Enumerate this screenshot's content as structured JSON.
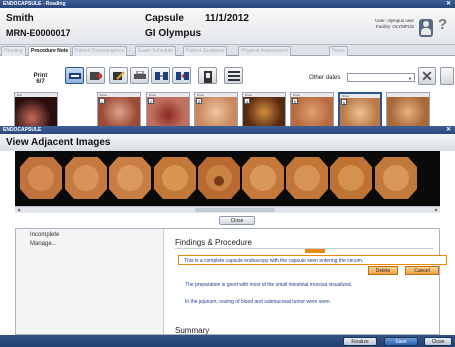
{
  "app": {
    "title": "ENDOCAPSULE - Reading"
  },
  "patient": {
    "name": "Smith",
    "mrn": "MRN-E0000017",
    "capsule_label": "Capsule",
    "date": "11/1/2012",
    "type": "GI Olympus"
  },
  "user": {
    "line1": "User: olympus user",
    "line2": "Facility: OLYMPUS"
  },
  "tabs": [
    "Reading",
    "Procedure Note",
    "Patient Demographics",
    "Exam Schedule",
    "Patient Guidance",
    "Physical Assessment",
    "Notes"
  ],
  "toolbar": {
    "print_label": "Print",
    "print_count": "6/7",
    "other_dates_label": "Other dates",
    "other_dates_value": ""
  },
  "thumbnails": [
    {
      "header": "Exit",
      "number": ""
    },
    {
      "header": "Draw",
      "number": "1"
    },
    {
      "header": "Draw",
      "number": "2"
    },
    {
      "header": "Draw",
      "number": "3"
    },
    {
      "header": "Draw",
      "number": "4"
    },
    {
      "header": "Draw",
      "number": "5"
    },
    {
      "header": "Draw",
      "number": "6"
    }
  ],
  "overlay": {
    "title": "ENDOCAPSULE",
    "heading": "View Adjacent Images",
    "close_label": "Close"
  },
  "left_list": [
    "Incomplete",
    "Manage..."
  ],
  "findings": {
    "heading": "Findings & Procedure",
    "selected_sentence": "This is a complete capsule endoscopy with the capsule seen entering the cecum.",
    "delete_label": "Delete",
    "cancel_label": "Cancel",
    "para1": "The preparation is good with most of the small intestinal mucosa visualized.",
    "para2": "In the jejunum, oozing of blood and submucosal tumor were seen.",
    "summary": "Summary"
  },
  "footer": {
    "finalize": "Finalize",
    "save": "Save",
    "close": "Close"
  },
  "colors": {
    "titlebar": "#2a477d",
    "accent_orange": "#e88a10",
    "text_blue": "#1e3f8a"
  }
}
